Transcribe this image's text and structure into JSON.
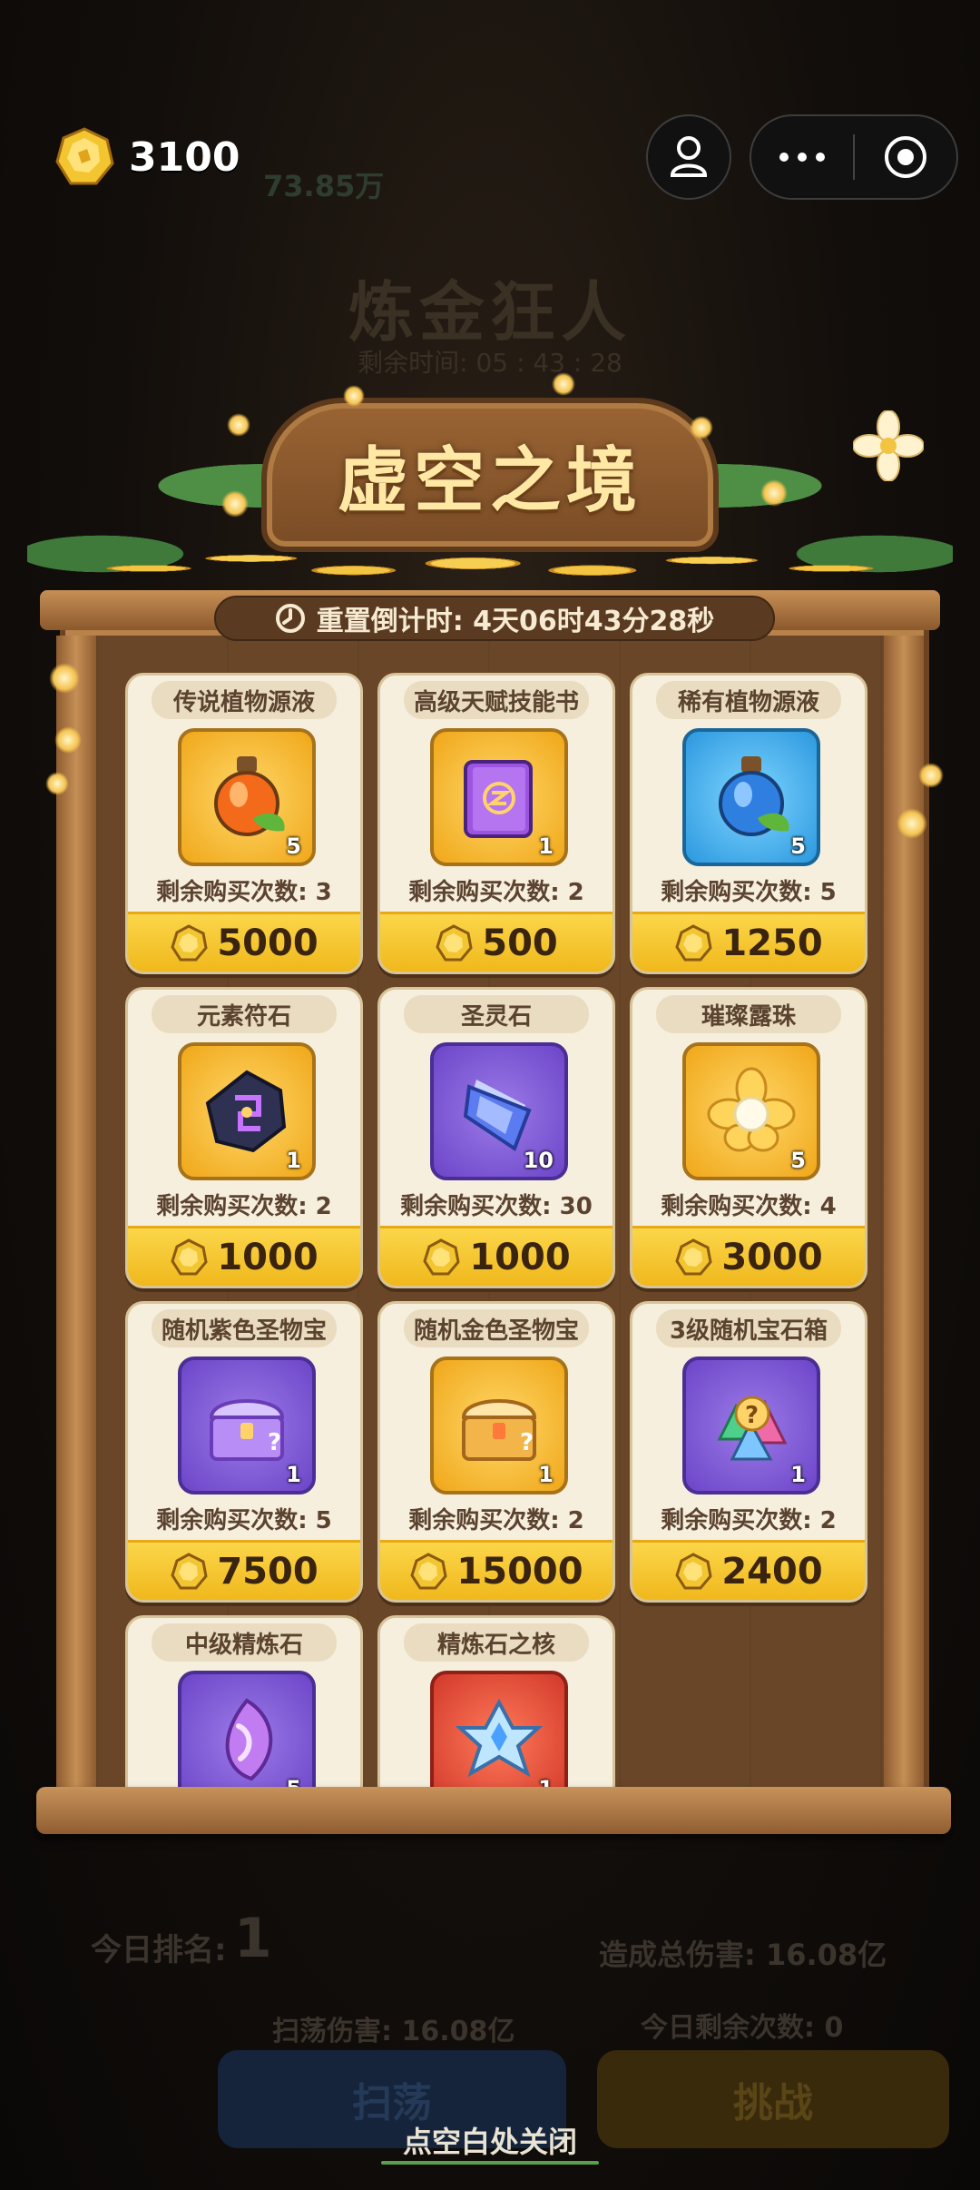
{
  "background": {
    "event_title": "炼金狂人",
    "event_timer": "剩余时间: 05 : 43 : 28",
    "bg_currency": "73.85万",
    "rank_label": "今日排名:",
    "rank_value": "1",
    "damage_total": "造成总伤害: 16.08亿",
    "sweep_damage": "扫荡伤害: 16.08亿",
    "remaining_today": "今日剩余次数: 0",
    "sweep_button": "扫荡",
    "challenge_button": "挑战"
  },
  "topbar": {
    "currency_value": "3100"
  },
  "shop": {
    "title": "虚空之境",
    "countdown": "重置倒计时: 4天06时43分28秒",
    "items": [
      {
        "name": "传说植物源液",
        "qty": "5",
        "remaining": "剩余购买次数: 3",
        "price": "5000",
        "icon": "orange-potion-icon",
        "box": "gold"
      },
      {
        "name": "高级天赋技能书",
        "qty": "1",
        "remaining": "剩余购买次数: 2",
        "price": "500",
        "icon": "skill-book-icon",
        "box": "gold"
      },
      {
        "name": "稀有植物源液",
        "qty": "5",
        "remaining": "剩余购买次数: 5",
        "price": "1250",
        "icon": "blue-potion-icon",
        "box": "blue"
      },
      {
        "name": "元素符石",
        "qty": "1",
        "remaining": "剩余购买次数: 2",
        "price": "1000",
        "icon": "rune-stone-icon",
        "box": "gold"
      },
      {
        "name": "圣灵石",
        "qty": "10",
        "remaining": "剩余购买次数: 30",
        "price": "1000",
        "icon": "spirit-crystal-icon",
        "box": "purple"
      },
      {
        "name": "璀璨露珠",
        "qty": "5",
        "remaining": "剩余购买次数: 4",
        "price": "3000",
        "icon": "dew-flower-icon",
        "box": "gold"
      },
      {
        "name": "随机紫色圣物宝",
        "qty": "1",
        "remaining": "剩余购买次数: 5",
        "price": "7500",
        "icon": "purple-chest-icon",
        "box": "purple"
      },
      {
        "name": "随机金色圣物宝",
        "qty": "1",
        "remaining": "剩余购买次数: 2",
        "price": "15000",
        "icon": "gold-chest-icon",
        "box": "gold"
      },
      {
        "name": "3级随机宝石箱",
        "qty": "1",
        "remaining": "剩余购买次数: 2",
        "price": "2400",
        "icon": "gem-box-icon",
        "box": "purple"
      },
      {
        "name": "中级精炼石",
        "qty": "5",
        "remaining": "",
        "price": "",
        "icon": "refine-stone-icon",
        "box": "purple"
      },
      {
        "name": "精炼石之核",
        "qty": "1",
        "remaining": "",
        "price": "",
        "icon": "refine-core-icon",
        "box": "red"
      }
    ]
  },
  "close_hint": "点空白处关闭",
  "colors": {
    "price_bar": "#f0b81c",
    "card_bg": "#f7efdd",
    "wood": "#9e6a3a"
  }
}
